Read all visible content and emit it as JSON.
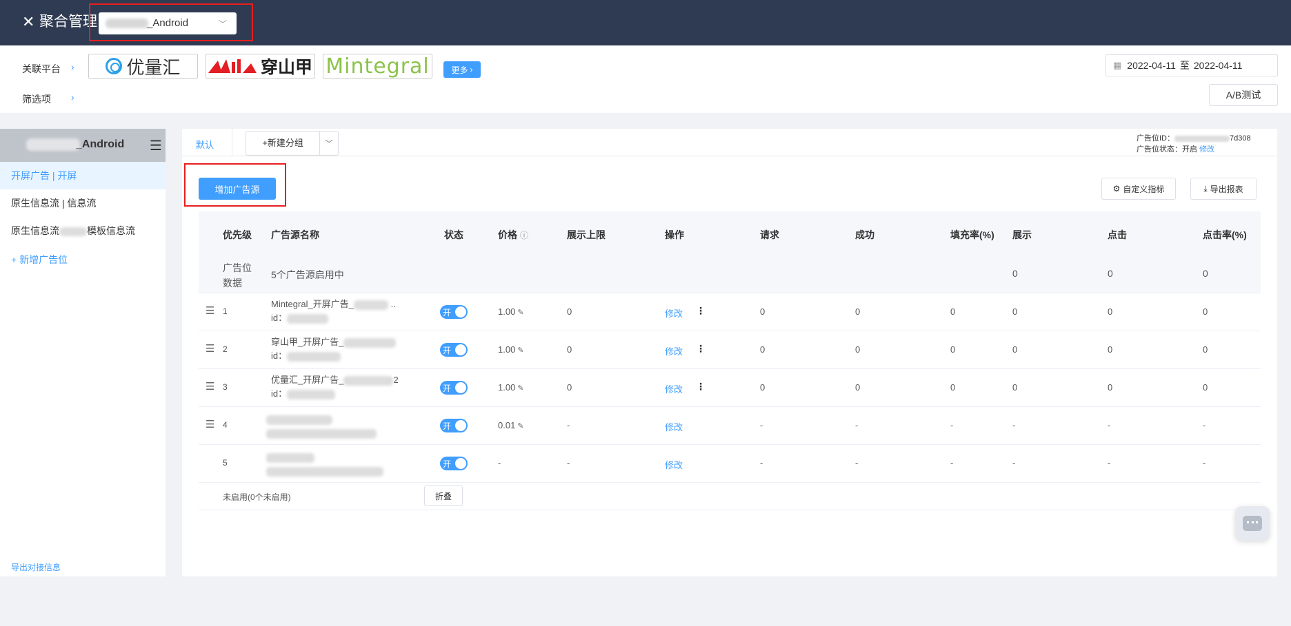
{
  "topbar": {
    "close_icon": "close-icon",
    "title": "聚合管理",
    "app_select_value": "_Android"
  },
  "filters": {
    "platform_label": "关联平台",
    "options_label": "筛选项",
    "platforms": [
      "优量汇",
      "穿山甲",
      "Mintegral"
    ],
    "more_label": "更多",
    "date_start": "2022-04-11",
    "date_sep": "至",
    "date_end": "2022-04-11",
    "ab_test": "A/B测试"
  },
  "sidebar": {
    "app_name": "_Android",
    "items": [
      {
        "label": "开屏广告 | 开屏"
      },
      {
        "label": "原生信息流 | 信息流"
      },
      {
        "label_pre": "原生信息流",
        "label_post": "模板信息流"
      }
    ],
    "add_slot": "+ 新增广告位",
    "export_info": "导出对接信息"
  },
  "main": {
    "tab_default": "默认",
    "new_group": "+新建分组",
    "slot_id_label": "广告位ID：",
    "slot_id_suffix": "7d308",
    "slot_status_label": "广告位状态：",
    "slot_status": "开启",
    "slot_edit": "修改",
    "add_source": "增加广告源",
    "custom_metrics": "自定义指标",
    "export_report": "导出报表"
  },
  "table": {
    "headers": [
      "优先级",
      "广告源名称",
      "状态",
      "价格",
      "展示上限",
      "操作",
      "请求",
      "成功",
      "填充率(%)",
      "展示",
      "点击",
      "点击率(%)"
    ],
    "summary": {
      "label_line1": "广告位",
      "label_line2": "数据",
      "desc": "5个广告源启用中",
      "show": "0",
      "click": "0",
      "ctr": "0"
    },
    "rows": [
      {
        "priority": "1",
        "name": "Mintegral_开屏广告_",
        "name_tail": "..",
        "id_label": "id：",
        "toggle": "开",
        "price": "1.00",
        "limit": "0",
        "edit": "修改",
        "req": "0",
        "succ": "0",
        "fill": "0",
        "show": "0",
        "click": "0",
        "ctr": "0"
      },
      {
        "priority": "2",
        "name": "穿山甲_开屏广告_",
        "name_tail": "",
        "id_label": "id：",
        "toggle": "开",
        "price": "1.00",
        "limit": "0",
        "edit": "修改",
        "req": "0",
        "succ": "0",
        "fill": "0",
        "show": "0",
        "click": "0",
        "ctr": "0"
      },
      {
        "priority": "3",
        "name": "优量汇_开屏广告_",
        "name_tail": "2",
        "id_label": "id：",
        "toggle": "开",
        "price": "1.00",
        "limit": "0",
        "edit": "修改",
        "req": "0",
        "succ": "0",
        "fill": "0",
        "show": "0",
        "click": "0",
        "ctr": "0"
      },
      {
        "priority": "4",
        "name": "",
        "name_tail": "",
        "id_label": "",
        "toggle": "开",
        "price": "0.01",
        "limit": "-",
        "edit": "修改",
        "req": "-",
        "succ": "-",
        "fill": "-",
        "show": "-",
        "click": "-",
        "ctr": "-"
      },
      {
        "priority": "5",
        "name": "",
        "name_tail": "",
        "id_label": "",
        "toggle": "开",
        "price": "-",
        "limit": "-",
        "edit": "修改",
        "req": "-",
        "succ": "-",
        "fill": "-",
        "show": "-",
        "click": "-",
        "ctr": "-"
      }
    ],
    "disabled_label": "未启用(0个未启用)",
    "collapse": "折叠"
  }
}
